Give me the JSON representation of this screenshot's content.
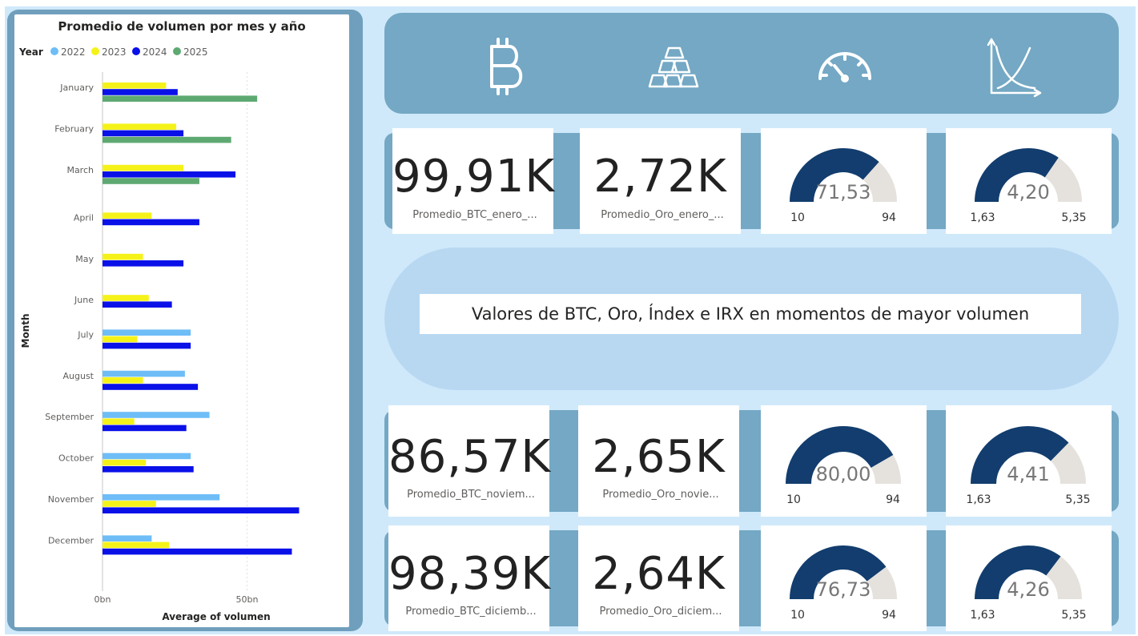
{
  "colors": {
    "2022": "#6ebdf7",
    "2023": "#f5f21a",
    "2024": "#0a10e8",
    "2025": "#5ea972",
    "gauge_fill": "#123d6e",
    "gauge_track": "#e5e2de",
    "banner": "#74a8c4",
    "background": "#cfe9fa"
  },
  "chart_data": {
    "type": "bar",
    "orientation": "horizontal",
    "title": "Promedio de volumen por mes y año",
    "legend_title": "Year",
    "legend_position": "top-left",
    "xlabel": "Average of volumen",
    "ylabel": "Month",
    "x_ticks": [
      "0bn",
      "50bn"
    ],
    "xlim": [
      0,
      80
    ],
    "unit": "bn",
    "grid": "vertical-dotted",
    "categories": [
      "January",
      "February",
      "March",
      "April",
      "May",
      "June",
      "July",
      "August",
      "September",
      "October",
      "November",
      "December"
    ],
    "series": [
      {
        "name": "2022",
        "values": [
          null,
          null,
          null,
          null,
          null,
          null,
          30.5,
          28.5,
          37.0,
          30.5,
          40.5,
          17.0
        ]
      },
      {
        "name": "2023",
        "values": [
          22.0,
          25.5,
          28.0,
          17.0,
          14.0,
          16.0,
          12.0,
          14.0,
          11.0,
          15.0,
          18.5,
          23.0
        ]
      },
      {
        "name": "2024",
        "values": [
          26.0,
          28.0,
          46.0,
          33.5,
          28.0,
          24.0,
          30.5,
          33.0,
          29.0,
          31.5,
          68.0,
          65.5
        ]
      },
      {
        "name": "2025",
        "values": [
          53.5,
          44.5,
          33.5,
          null,
          null,
          null,
          null,
          null,
          null,
          null,
          null,
          null
        ]
      }
    ]
  },
  "icons": [
    "bitcoin-icon",
    "gold-bars-icon",
    "speedometer-icon",
    "graph-icon"
  ],
  "row1": {
    "kpi1": {
      "value": "99,91K",
      "label": "Promedio_BTC_enero_..."
    },
    "kpi2": {
      "value": "2,72K",
      "label": "Promedio_Oro_enero_..."
    },
    "gauge1": {
      "value": "71,53",
      "min": "10",
      "max": "94",
      "num": 71.53,
      "num_min": 10,
      "num_max": 94
    },
    "gauge2": {
      "value": "4,20",
      "min": "1,63",
      "max": "5,35",
      "num": 4.2,
      "num_min": 1.63,
      "num_max": 5.35
    }
  },
  "pill": {
    "text": "Valores de BTC, Oro, Índex e IRX en momentos de mayor volumen"
  },
  "row2": {
    "kpi1": {
      "value": "86,57K",
      "label": "Promedio_BTC_noviem..."
    },
    "kpi2": {
      "value": "2,65K",
      "label": "Promedio_Oro_novie..."
    },
    "gauge1": {
      "value": "80,00",
      "min": "10",
      "max": "94",
      "num": 80.0,
      "num_min": 10,
      "num_max": 94
    },
    "gauge2": {
      "value": "4,41",
      "min": "1,63",
      "max": "5,35",
      "num": 4.41,
      "num_min": 1.63,
      "num_max": 5.35
    }
  },
  "row3": {
    "kpi1": {
      "value": "98,39K",
      "label": "Promedio_BTC_diciemb..."
    },
    "kpi2": {
      "value": "2,64K",
      "label": "Promedio_Oro_diciem..."
    },
    "gauge1": {
      "value": "76,73",
      "min": "10",
      "max": "94",
      "num": 76.73,
      "num_min": 10,
      "num_max": 94
    },
    "gauge2": {
      "value": "4,26",
      "min": "1,63",
      "max": "5,35",
      "num": 4.26,
      "num_min": 1.63,
      "num_max": 5.35
    }
  }
}
